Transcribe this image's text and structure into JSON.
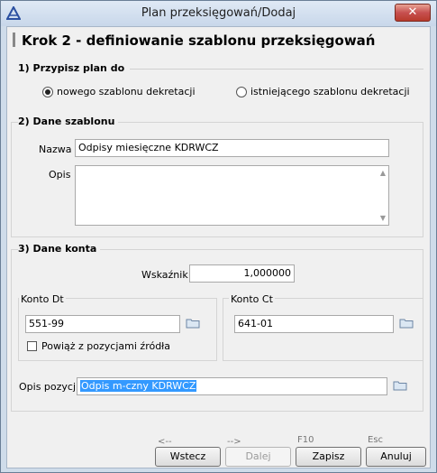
{
  "window": {
    "title": "Plan przeksięgowań/Dodaj",
    "close_label": "✕"
  },
  "heading": "Krok 2 - definiowanie szablonu przeksięgowań",
  "section1": {
    "title": "1) Przypisz plan do",
    "option_new": "nowego szablonu dekretacji",
    "option_existing": "istniejącego szablonu dekretacji",
    "selected": "new"
  },
  "section2": {
    "title": "2) Dane szablonu",
    "name_label": "Nazwa",
    "name_value": "Odpisy miesięczne KDRWCZ",
    "desc_label": "Opis",
    "desc_value": ""
  },
  "section3": {
    "title": "3) Dane konta",
    "ratio_label": "Wskaźnik",
    "ratio_value": "1,000000",
    "dt_title": "Konto Dt",
    "dt_value": "551-99",
    "link_label": "Powiąż z pozycjami źródła",
    "link_checked": false,
    "ct_title": "Konto Ct",
    "ct_value": "641-01",
    "pos_desc_label": "Opis pozycji",
    "pos_desc_value": "Odpis m-czny KDRWCZ"
  },
  "footer": {
    "back_hint": "<--",
    "back_label": "Wstecz",
    "next_hint": "-->",
    "next_label": "Dalej",
    "save_hint": "F10",
    "save_label": "Zapisz",
    "cancel_hint": "Esc",
    "cancel_label": "Anuluj"
  },
  "colors": {
    "selection": "#3399ff",
    "close": "#c75050"
  }
}
